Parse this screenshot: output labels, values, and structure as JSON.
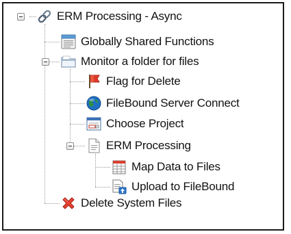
{
  "tree": {
    "root": {
      "label": "ERM Processing - Async",
      "icon": "chain-link-icon"
    },
    "globally_shared": {
      "label": "Globally Shared Functions",
      "icon": "calendar-list-icon"
    },
    "monitor_folder": {
      "label": "Monitor a folder for files",
      "icon": "folder-icon"
    },
    "flag_delete": {
      "label": "Flag for Delete",
      "icon": "red-flag-icon"
    },
    "filebound_connect": {
      "label": "FileBound Server Connect",
      "icon": "globe-icon"
    },
    "choose_project": {
      "label": "Choose Project",
      "icon": "window-form-icon"
    },
    "erm_processing": {
      "label": "ERM Processing",
      "icon": "document-icon"
    },
    "map_data": {
      "label": "Map Data to Files",
      "icon": "table-calendar-icon"
    },
    "upload_filebound": {
      "label": "Upload to FileBound",
      "icon": "upload-document-icon"
    },
    "delete_system_files": {
      "label": "Delete System Files",
      "icon": "red-x-icon"
    }
  },
  "colors": {
    "frame_border": "#1a1a1a",
    "connector": "#9a9a9a",
    "flag_red": "#e03a2a",
    "globe_blue": "#1f6fc4",
    "x_red": "#d9342b"
  }
}
